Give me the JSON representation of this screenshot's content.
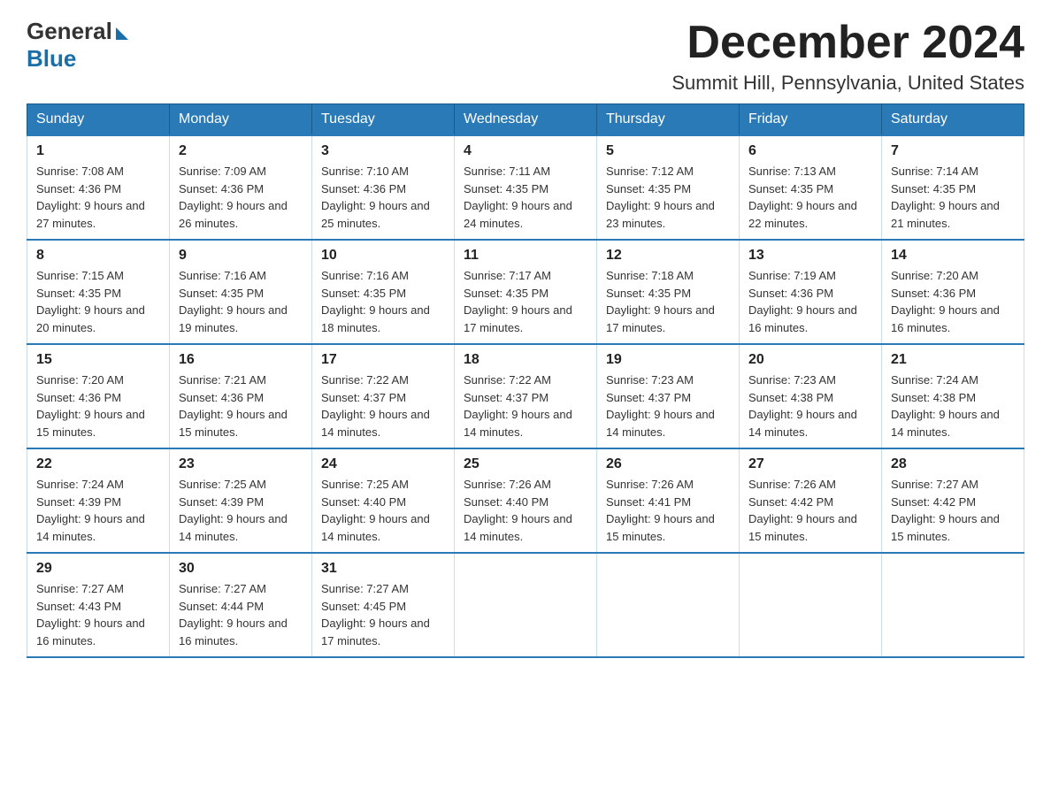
{
  "header": {
    "logo_general": "General",
    "logo_blue": "Blue",
    "title": "December 2024",
    "subtitle": "Summit Hill, Pennsylvania, United States"
  },
  "days_of_week": [
    "Sunday",
    "Monday",
    "Tuesday",
    "Wednesday",
    "Thursday",
    "Friday",
    "Saturday"
  ],
  "weeks": [
    [
      {
        "day": "1",
        "sunrise": "Sunrise: 7:08 AM",
        "sunset": "Sunset: 4:36 PM",
        "daylight": "Daylight: 9 hours and 27 minutes."
      },
      {
        "day": "2",
        "sunrise": "Sunrise: 7:09 AM",
        "sunset": "Sunset: 4:36 PM",
        "daylight": "Daylight: 9 hours and 26 minutes."
      },
      {
        "day": "3",
        "sunrise": "Sunrise: 7:10 AM",
        "sunset": "Sunset: 4:36 PM",
        "daylight": "Daylight: 9 hours and 25 minutes."
      },
      {
        "day": "4",
        "sunrise": "Sunrise: 7:11 AM",
        "sunset": "Sunset: 4:35 PM",
        "daylight": "Daylight: 9 hours and 24 minutes."
      },
      {
        "day": "5",
        "sunrise": "Sunrise: 7:12 AM",
        "sunset": "Sunset: 4:35 PM",
        "daylight": "Daylight: 9 hours and 23 minutes."
      },
      {
        "day": "6",
        "sunrise": "Sunrise: 7:13 AM",
        "sunset": "Sunset: 4:35 PM",
        "daylight": "Daylight: 9 hours and 22 minutes."
      },
      {
        "day": "7",
        "sunrise": "Sunrise: 7:14 AM",
        "sunset": "Sunset: 4:35 PM",
        "daylight": "Daylight: 9 hours and 21 minutes."
      }
    ],
    [
      {
        "day": "8",
        "sunrise": "Sunrise: 7:15 AM",
        "sunset": "Sunset: 4:35 PM",
        "daylight": "Daylight: 9 hours and 20 minutes."
      },
      {
        "day": "9",
        "sunrise": "Sunrise: 7:16 AM",
        "sunset": "Sunset: 4:35 PM",
        "daylight": "Daylight: 9 hours and 19 minutes."
      },
      {
        "day": "10",
        "sunrise": "Sunrise: 7:16 AM",
        "sunset": "Sunset: 4:35 PM",
        "daylight": "Daylight: 9 hours and 18 minutes."
      },
      {
        "day": "11",
        "sunrise": "Sunrise: 7:17 AM",
        "sunset": "Sunset: 4:35 PM",
        "daylight": "Daylight: 9 hours and 17 minutes."
      },
      {
        "day": "12",
        "sunrise": "Sunrise: 7:18 AM",
        "sunset": "Sunset: 4:35 PM",
        "daylight": "Daylight: 9 hours and 17 minutes."
      },
      {
        "day": "13",
        "sunrise": "Sunrise: 7:19 AM",
        "sunset": "Sunset: 4:36 PM",
        "daylight": "Daylight: 9 hours and 16 minutes."
      },
      {
        "day": "14",
        "sunrise": "Sunrise: 7:20 AM",
        "sunset": "Sunset: 4:36 PM",
        "daylight": "Daylight: 9 hours and 16 minutes."
      }
    ],
    [
      {
        "day": "15",
        "sunrise": "Sunrise: 7:20 AM",
        "sunset": "Sunset: 4:36 PM",
        "daylight": "Daylight: 9 hours and 15 minutes."
      },
      {
        "day": "16",
        "sunrise": "Sunrise: 7:21 AM",
        "sunset": "Sunset: 4:36 PM",
        "daylight": "Daylight: 9 hours and 15 minutes."
      },
      {
        "day": "17",
        "sunrise": "Sunrise: 7:22 AM",
        "sunset": "Sunset: 4:37 PM",
        "daylight": "Daylight: 9 hours and 14 minutes."
      },
      {
        "day": "18",
        "sunrise": "Sunrise: 7:22 AM",
        "sunset": "Sunset: 4:37 PM",
        "daylight": "Daylight: 9 hours and 14 minutes."
      },
      {
        "day": "19",
        "sunrise": "Sunrise: 7:23 AM",
        "sunset": "Sunset: 4:37 PM",
        "daylight": "Daylight: 9 hours and 14 minutes."
      },
      {
        "day": "20",
        "sunrise": "Sunrise: 7:23 AM",
        "sunset": "Sunset: 4:38 PM",
        "daylight": "Daylight: 9 hours and 14 minutes."
      },
      {
        "day": "21",
        "sunrise": "Sunrise: 7:24 AM",
        "sunset": "Sunset: 4:38 PM",
        "daylight": "Daylight: 9 hours and 14 minutes."
      }
    ],
    [
      {
        "day": "22",
        "sunrise": "Sunrise: 7:24 AM",
        "sunset": "Sunset: 4:39 PM",
        "daylight": "Daylight: 9 hours and 14 minutes."
      },
      {
        "day": "23",
        "sunrise": "Sunrise: 7:25 AM",
        "sunset": "Sunset: 4:39 PM",
        "daylight": "Daylight: 9 hours and 14 minutes."
      },
      {
        "day": "24",
        "sunrise": "Sunrise: 7:25 AM",
        "sunset": "Sunset: 4:40 PM",
        "daylight": "Daylight: 9 hours and 14 minutes."
      },
      {
        "day": "25",
        "sunrise": "Sunrise: 7:26 AM",
        "sunset": "Sunset: 4:40 PM",
        "daylight": "Daylight: 9 hours and 14 minutes."
      },
      {
        "day": "26",
        "sunrise": "Sunrise: 7:26 AM",
        "sunset": "Sunset: 4:41 PM",
        "daylight": "Daylight: 9 hours and 15 minutes."
      },
      {
        "day": "27",
        "sunrise": "Sunrise: 7:26 AM",
        "sunset": "Sunset: 4:42 PM",
        "daylight": "Daylight: 9 hours and 15 minutes."
      },
      {
        "day": "28",
        "sunrise": "Sunrise: 7:27 AM",
        "sunset": "Sunset: 4:42 PM",
        "daylight": "Daylight: 9 hours and 15 minutes."
      }
    ],
    [
      {
        "day": "29",
        "sunrise": "Sunrise: 7:27 AM",
        "sunset": "Sunset: 4:43 PM",
        "daylight": "Daylight: 9 hours and 16 minutes."
      },
      {
        "day": "30",
        "sunrise": "Sunrise: 7:27 AM",
        "sunset": "Sunset: 4:44 PM",
        "daylight": "Daylight: 9 hours and 16 minutes."
      },
      {
        "day": "31",
        "sunrise": "Sunrise: 7:27 AM",
        "sunset": "Sunset: 4:45 PM",
        "daylight": "Daylight: 9 hours and 17 minutes."
      },
      null,
      null,
      null,
      null
    ]
  ]
}
